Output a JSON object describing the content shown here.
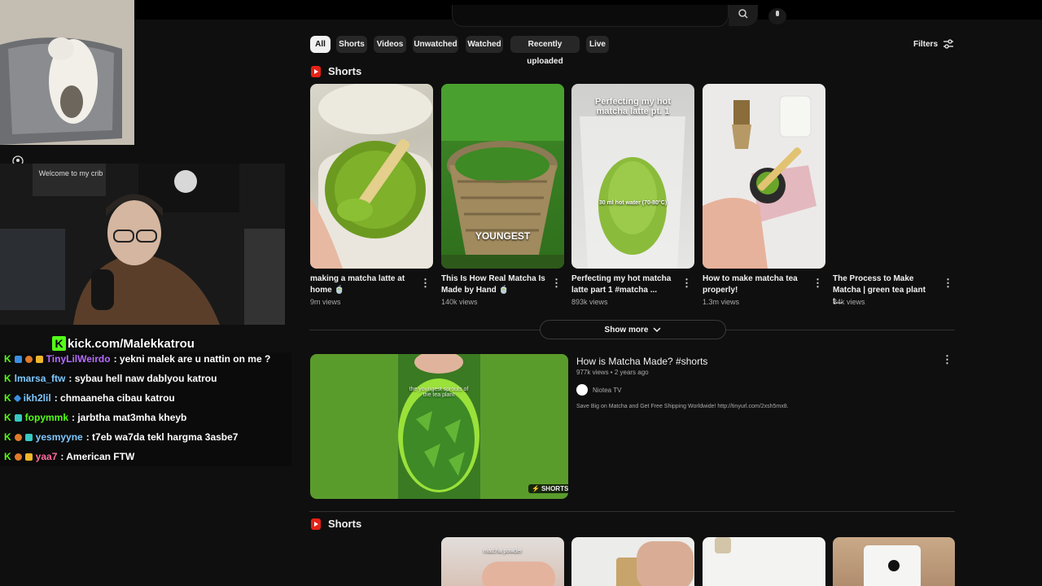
{
  "filters": {
    "chips": [
      "All",
      "Shorts",
      "Videos",
      "Unwatched",
      "Watched",
      "Recently uploaded",
      "Live"
    ],
    "active": "All",
    "filters_label": "Filters"
  },
  "shorts_section_1": {
    "heading": "Shorts",
    "items": [
      {
        "title": "making a matcha latte at home 🍵",
        "views": "9m views"
      },
      {
        "title": "This Is How Real Matcha Is Made by Hand 🍵",
        "views": "140k views",
        "overlay": "YOUNGEST"
      },
      {
        "title": "Perfecting my hot matcha latte part 1 #matcha ...",
        "views": "893k views",
        "overlay": "Perfecting my hot matcha latte pt. 1",
        "overlay2": "30 ml hot water (70-80°C)"
      },
      {
        "title": "How to make matcha tea properly!",
        "views": "1.3m views"
      },
      {
        "title": "The Process to Make Matcha | green tea plant t...",
        "views": "84k views"
      }
    ],
    "show_more": "Show more"
  },
  "video_result": {
    "title": "How is Matcha Made? #shorts",
    "meta": "977k views • 2 years ago",
    "channel": "Niotea TV",
    "description": "Save Big on Matcha and Get Free Shipping Worldwide! http://tinyurl.com/2xsh5mx8.",
    "badge": "SHORTS",
    "overlay": "the youngest sprouts of the tea plant"
  },
  "shorts_section_2": {
    "heading": "Shorts",
    "overlay": "matcha powder"
  },
  "stream": {
    "webcam_sign": "Welcome to my crib",
    "kick_url": "kick.com/Malekkatrou"
  },
  "chat": [
    {
      "user": "TinyLilWeirdo",
      "msg": ": yekni malek are u nattin on me ?",
      "color": "#b76cff"
    },
    {
      "user": "lmarsa_ftw",
      "msg": ": sybau hell naw dablyou katrou",
      "color": "#7ec8ff"
    },
    {
      "user": "ikh2lil",
      "msg": ": chmaaneha cibau katrou",
      "color": "#7ec8ff"
    },
    {
      "user": "fopymmk",
      "msg": ": jarbtha mat3mha kheyb",
      "color": "#53fc18"
    },
    {
      "user": "yesmyyne",
      "msg": ": t7eb wa7da tekl hargma 3asbe7",
      "color": "#7ec8ff"
    },
    {
      "user": "yaa7",
      "msg": ": American FTW",
      "color": "#ff6b9d"
    }
  ],
  "colors": {
    "kick_green": "#53fc18",
    "shorts_red": "#e62117",
    "bg": "#0f0f0f"
  }
}
